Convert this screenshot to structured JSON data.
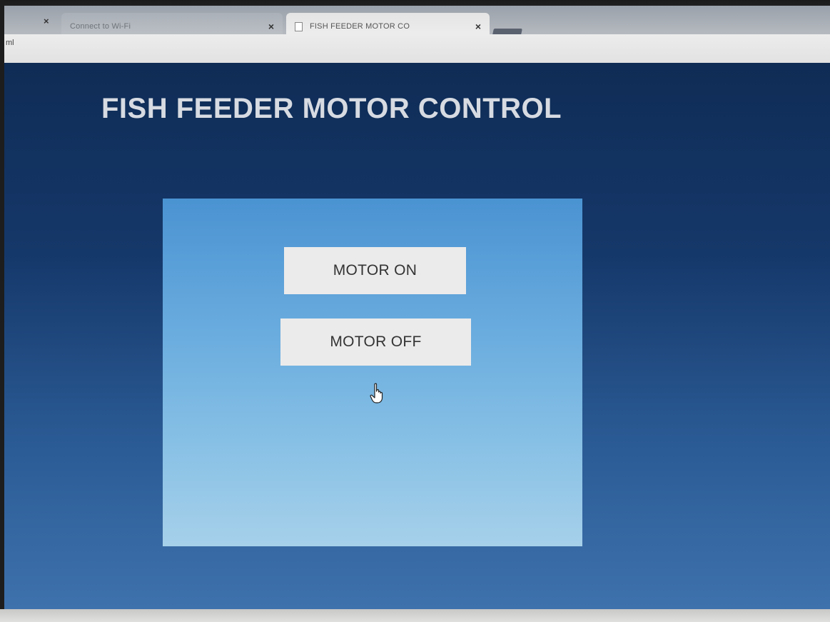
{
  "browser": {
    "tabs": [
      {
        "title": "Connect to Wi-Fi",
        "active": false
      },
      {
        "title": "FISH FEEDER MOTOR CO",
        "active": true
      }
    ],
    "close_glyph": "×",
    "url_fragment": "ml"
  },
  "page": {
    "title": "FISH FEEDER MOTOR CONTROL",
    "buttons": {
      "motor_on": "MOTOR ON",
      "motor_off": "MOTOR OFF"
    }
  },
  "colors": {
    "page_background": "#15386a",
    "panel_background": "#6fb0e0",
    "button_background": "#ebebeb",
    "title_text": "#d7dbe2"
  }
}
